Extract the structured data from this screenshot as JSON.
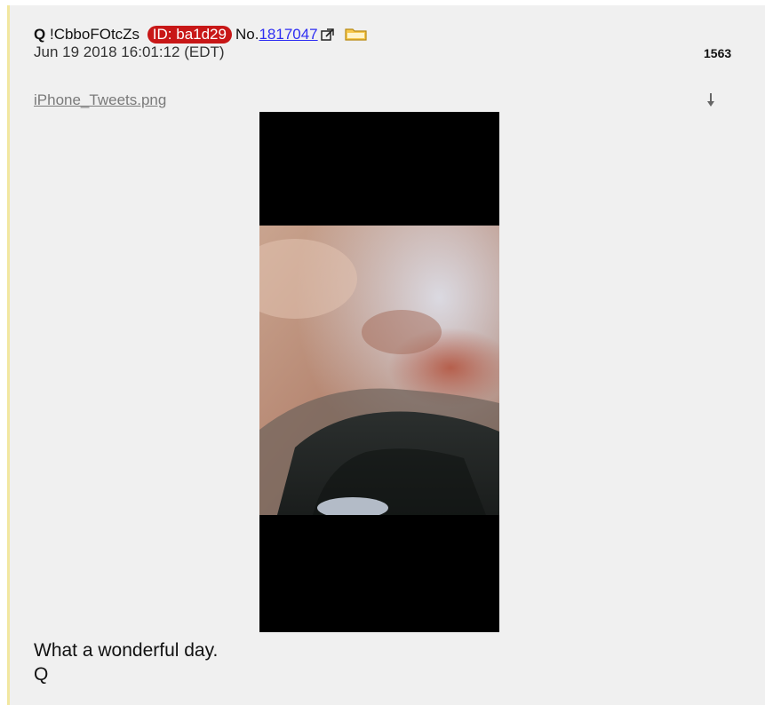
{
  "post": {
    "name": "Q",
    "tripcode": "!CbboFOtcZs",
    "id_badge": "ID: ba1d29",
    "no_label": "No.",
    "number": "1817047",
    "date": "Jun 19 2018 16:01:12 (EDT)",
    "count": "1563",
    "filename": "iPhone_Tweets.png",
    "body_lines": [
      "What a wonderful day.",
      "Q"
    ]
  },
  "icons": {
    "external_link": "external-link-icon",
    "folder": "folder-icon",
    "download": "download-arrow-icon"
  },
  "colors": {
    "id_badge_bg": "#c81717",
    "link": "#2e2ef2",
    "post_bg": "#f0f0f0",
    "left_border": "#f2e7a0"
  }
}
